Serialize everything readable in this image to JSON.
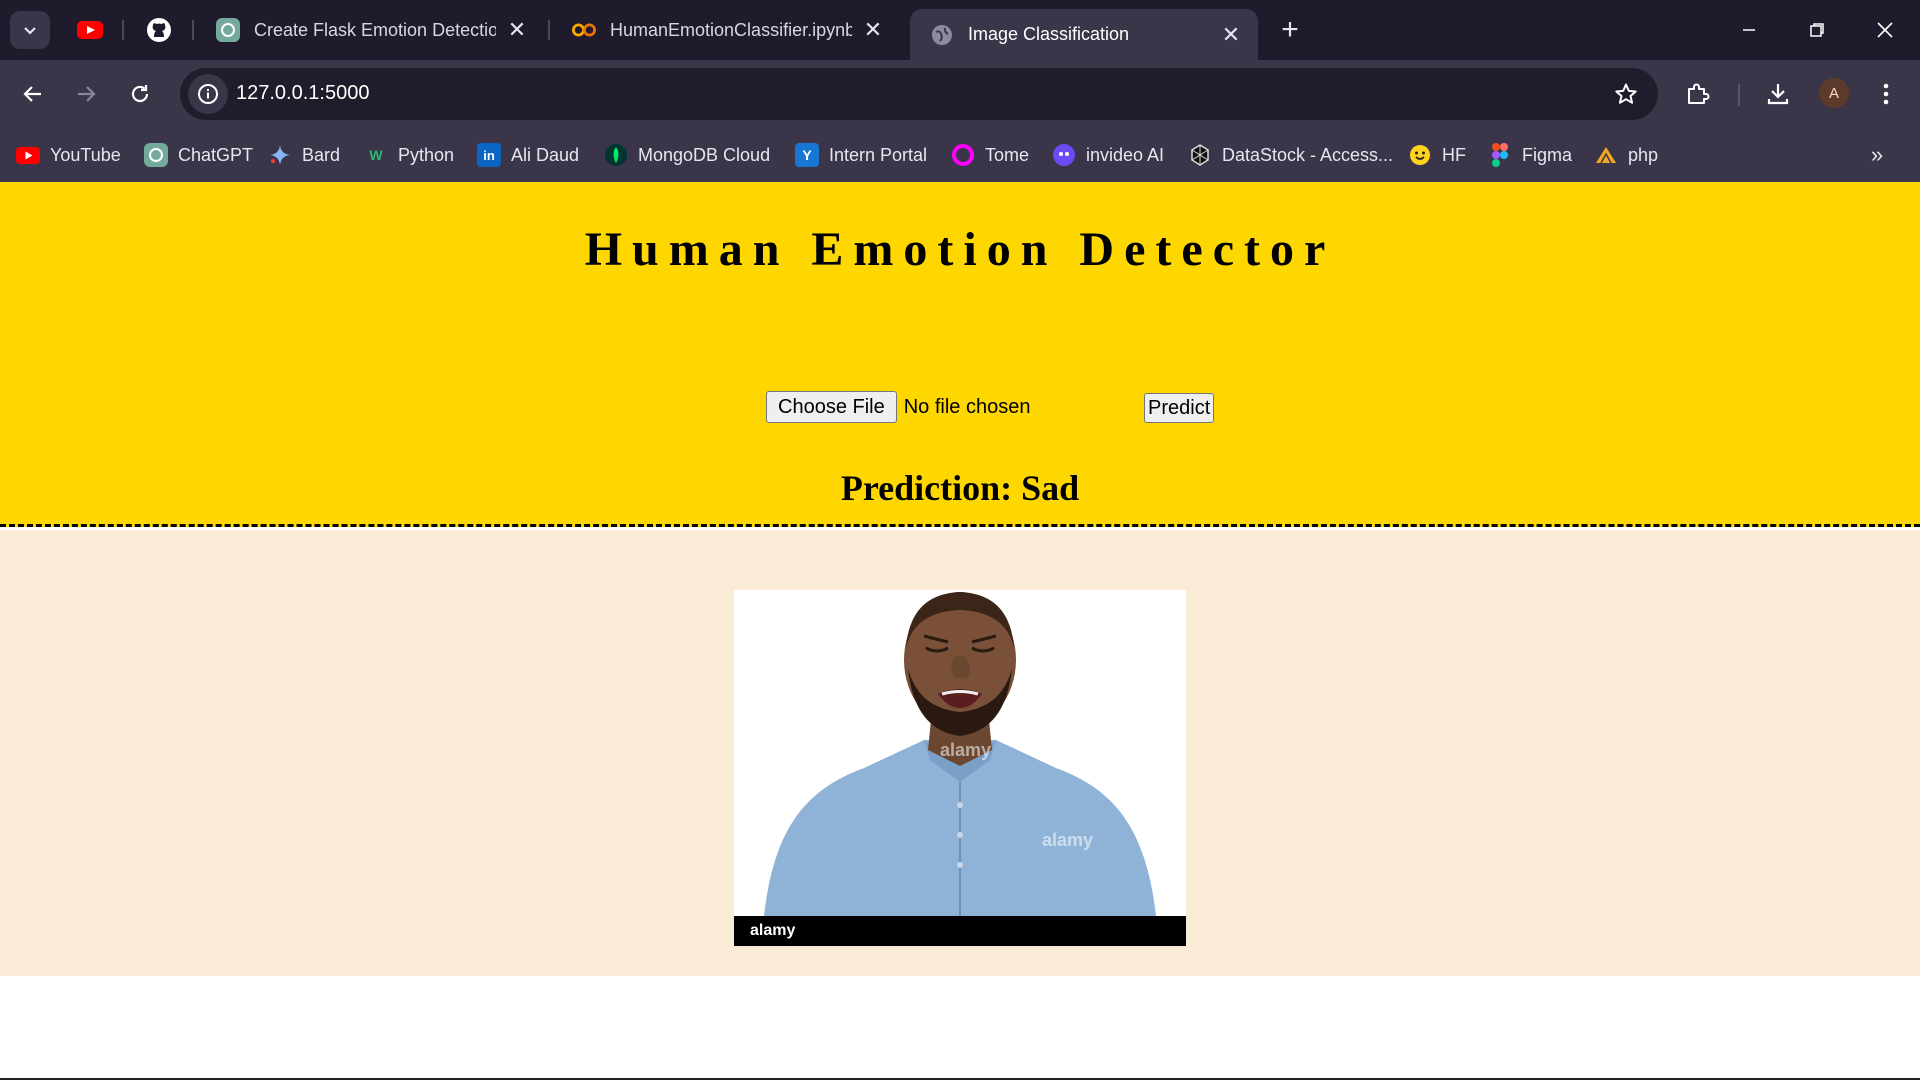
{
  "browser": {
    "tabs": [
      {
        "title": "Create Flask Emotion Detection",
        "active": false
      },
      {
        "title": "HumanEmotionClassifier.ipynb",
        "active": false
      },
      {
        "title": "Image Classification",
        "active": true
      }
    ],
    "url": "127.0.0.1:5000",
    "profile_initial": "A",
    "bookmarks": [
      {
        "label": "YouTube",
        "icon": "youtube-icon"
      },
      {
        "label": "ChatGPT",
        "icon": "chatgpt-icon"
      },
      {
        "label": "Bard",
        "icon": "bard-icon"
      },
      {
        "label": "Python",
        "icon": "python-icon"
      },
      {
        "label": "Ali Daud",
        "icon": "linkedin-icon"
      },
      {
        "label": "MongoDB Cloud",
        "icon": "mongodb-icon"
      },
      {
        "label": "Intern Portal",
        "icon": "portal-icon"
      },
      {
        "label": "Tome",
        "icon": "tome-icon"
      },
      {
        "label": "invideo AI",
        "icon": "invideo-icon"
      },
      {
        "label": "DataStock - Access...",
        "icon": "datastock-icon"
      },
      {
        "label": "HF",
        "icon": "huggingface-icon"
      },
      {
        "label": "Figma",
        "icon": "figma-icon"
      },
      {
        "label": "php",
        "icon": "php-icon"
      }
    ]
  },
  "page": {
    "title": "Human Emotion Detector",
    "file_input": {
      "button_label": "Choose File",
      "status": "No file chosen"
    },
    "predict_label": "Predict",
    "prediction": "Prediction: Sad",
    "image": {
      "description_icon": "crying-man-photo",
      "footer_logo": "alamy",
      "watermark": "alamy"
    }
  },
  "colors": {
    "header_band": "#ffd700",
    "result_band": "#faebd7",
    "tabstrip": "#1f1b2c",
    "toolbar": "#3a3548"
  }
}
